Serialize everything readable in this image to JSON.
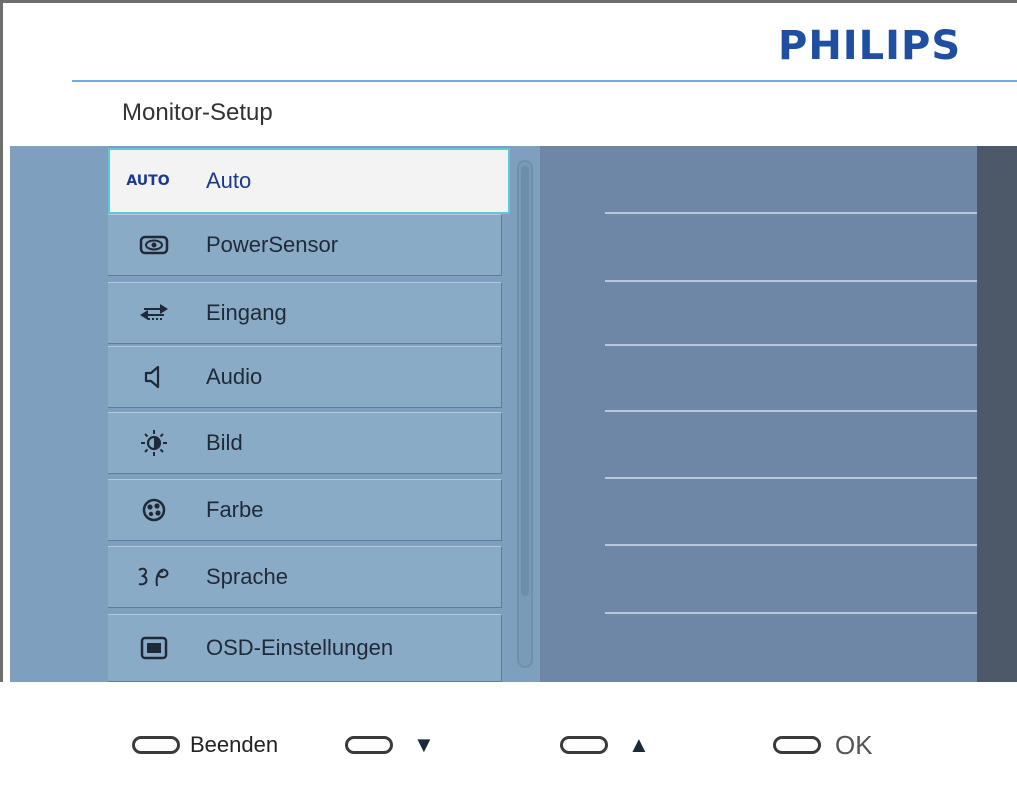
{
  "brand": "PHILIPS",
  "title": "Monitor-Setup",
  "menu": [
    {
      "label": "Auto",
      "icon": "auto-text-icon",
      "icon_text": "AUTO",
      "selected": true
    },
    {
      "label": "PowerSensor",
      "icon": "eye-sensor-icon",
      "selected": false
    },
    {
      "label": "Eingang",
      "icon": "input-arrows-icon",
      "selected": false
    },
    {
      "label": "Audio",
      "icon": "speaker-icon",
      "selected": false
    },
    {
      "label": "Bild",
      "icon": "brightness-sun-icon",
      "selected": false
    },
    {
      "label": "Farbe",
      "icon": "color-palette-icon",
      "selected": false
    },
    {
      "label": "Sprache",
      "icon": "language-icon",
      "selected": false
    },
    {
      "label": "OSD-Einstellungen",
      "icon": "osd-screen-icon",
      "selected": false
    }
  ],
  "footer": {
    "exit_label": "Beenden",
    "down_glyph": "▼",
    "up_glyph": "▲",
    "ok_label": "OK"
  },
  "colors": {
    "brand_blue": "#1f4fa0",
    "panel": "#7e9fbd",
    "selection_border": "#5cc8d8"
  }
}
